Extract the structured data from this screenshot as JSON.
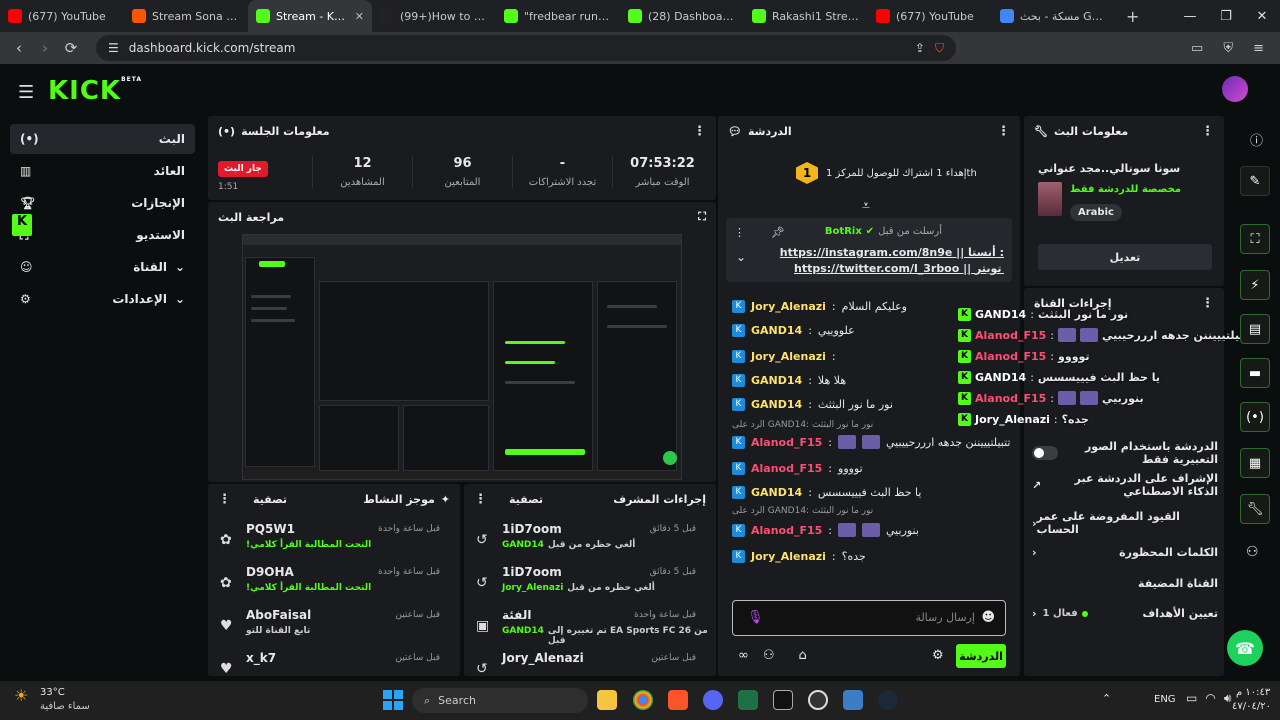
{
  "browser": {
    "tabs": [
      {
        "label": "(677) YouTube",
        "color": "#ff0000"
      },
      {
        "label": "Stream Sona | Listen",
        "color": "#ff5500"
      },
      {
        "label": "Stream - Kick",
        "color": "#53fc18",
        "active": true
      },
      {
        "label": "(99+)How to Down",
        "color": "#222222"
      },
      {
        "label": "\"fredbear running\"",
        "color": "#53fc18"
      },
      {
        "label": "(28) Dashboard / St",
        "color": "#53fc18"
      },
      {
        "label": "Rakashi1 Stream - V",
        "color": "#53fc18"
      },
      {
        "label": "(677) YouTube",
        "color": "#ff0000"
      },
      {
        "label": "مسكة - بحث Google",
        "color": "#4285f4"
      }
    ],
    "url": "dashboard.kick.com/stream"
  },
  "logo": {
    "text": "KICK",
    "beta": "BETA"
  },
  "sidebar": {
    "items": [
      {
        "label": "البث",
        "icon": "broadcast-icon"
      },
      {
        "label": "العائد",
        "icon": "chart-icon"
      },
      {
        "label": "الإنجازات",
        "icon": "trophy-icon"
      },
      {
        "label": "الاستديو",
        "icon": "studio-icon"
      },
      {
        "label": "القناة",
        "icon": "user-icon"
      },
      {
        "label": "الإعدادات",
        "icon": "gear-icon"
      }
    ]
  },
  "session": {
    "title": "معلومات الجلسة",
    "live_badge": "جار البث",
    "live_sub": "1:51",
    "stats": [
      {
        "value": "12",
        "label": "المشاهدين"
      },
      {
        "value": "96",
        "label": "المتابعين"
      },
      {
        "value": "-",
        "label": "تجدد الاشتراكات"
      },
      {
        "value": "07:53:22",
        "label": "الوقت مباشر"
      }
    ]
  },
  "preview": {
    "title": "مراجعة البث"
  },
  "activity": {
    "title": "موجز النشاط",
    "filter": "تصفية",
    "items": [
      {
        "name": "PQ5W1",
        "sub": "!التحت المطالبة القرأ كلامي",
        "time": "قبل ساعة واحدة",
        "icon": "gift-icon"
      },
      {
        "name": "D9OHA",
        "sub": "!التحت المطالبة القرأ كلامي",
        "time": "قبل ساعة واحدة",
        "icon": "gift-icon"
      },
      {
        "name": "AboFaisal",
        "sub": "تابع القناة للتو",
        "time": "قبل ساعتين",
        "icon": "heart-icon"
      },
      {
        "name": "x_k7",
        "sub": "",
        "time": "قبل ساعتين",
        "icon": "heart-icon"
      }
    ]
  },
  "modactions": {
    "title": "إجراءات المشرف",
    "filter": "تصفية",
    "items": [
      {
        "name": "1iD7oom",
        "sub": "ألغي حظره من قبل",
        "by": "GAND14",
        "time": "قبل 5 دقائق"
      },
      {
        "name": "1iD7oom",
        "sub": "ألغي حظره من قبل",
        "by": "Jory_Alenazi",
        "time": "قبل 5 دقائق"
      },
      {
        "name": "الفئة",
        "sub": "تم تغييره إلى EA Sports FC 26 من قبل",
        "by": "GAND14",
        "time": "قبل ساعة واحدة"
      },
      {
        "name": "Jory_Alenazi",
        "sub": "",
        "by": "",
        "time": "قبل ساعتين"
      }
    ]
  },
  "chat": {
    "title": "الدردشة",
    "goal": "إهداء 1 اشتراك للوصول للمركز 1th",
    "goal_rank": "1",
    "pinned_user": "BotRix",
    "pinned_label": "أرسلت من قبل",
    "pinned_line1": "https://instagram.com/8n9e || أنستا :",
    "pinned_line2": "https://twitter.com/l_3rboo || تويتر :",
    "messages": [
      {
        "user": "Jory_Alenazi",
        "text": "وعليكم السلام",
        "color": "y"
      },
      {
        "user": "GAND14",
        "text": "علووييي",
        "color": "y"
      },
      {
        "user": "Jory_Alenazi",
        "text": "",
        "color": "y"
      },
      {
        "user": "GAND14",
        "text": "هلا هلا",
        "color": "y"
      },
      {
        "user": "GAND14",
        "text": "نور ما نور البثثث",
        "color": "y"
      },
      {
        "user": "Alanod_F15",
        "text": "تتبيلتيييننن جدهه ارررحييبيي",
        "color": "p"
      },
      {
        "user": "Alanod_F15",
        "text": "توووو",
        "color": "p"
      },
      {
        "user": "GAND14",
        "text": "يا حظ البث فيييسسس",
        "color": "y"
      },
      {
        "user": "Alanod_F15",
        "text": "بنوربيي",
        "color": "p"
      },
      {
        "user": "Jory_Alenazi",
        "text": "جده؟",
        "color": "y"
      }
    ],
    "reply1": "الرد على GAND14: نور ما نور البثثث",
    "reply2": "الرد على GAND14: نور ما نور البثثث",
    "input_placeholder": "إرسال رسالة",
    "send_label": "الدردشة"
  },
  "streaminfo": {
    "title": "معلومات البث",
    "stream_title": "سونا سونالي..مجد عنواني",
    "category": "مخصصة للدردشة فقط",
    "lang": "Arabic",
    "edit": "تعديل"
  },
  "channel_actions": {
    "title": "إجراءات القناة",
    "rows": [
      {
        "label": "الدردشة باستخدام الصور التعبيرية فقط",
        "kind": "toggle"
      },
      {
        "label": "الإشراف على الدردشة عبر الذكاء الاصطناعي",
        "kind": "link"
      },
      {
        "label": "القيود المفروضة على عمر الحساب",
        "kind": "chevron"
      },
      {
        "label": "الكلمات المحظورة",
        "kind": "chevron"
      },
      {
        "label": "القناة المضيفة",
        "kind": "none"
      },
      {
        "label": "تعيين الأهداف",
        "kind": "goal",
        "extra": "فعال 1"
      }
    ]
  },
  "overlay_chat": [
    {
      "user": "GAND14",
      "text": "نور ما نور البثثث",
      "color": "w"
    },
    {
      "user": "Alanod_F15",
      "text": "تتبيلتيييننن جدهه ارررحيبيي",
      "color": "p"
    },
    {
      "user": "Alanod_F15",
      "text": "توووو",
      "color": "p"
    },
    {
      "user": "GAND14",
      "text": "يا حظ البث فيييسسس",
      "color": "w"
    },
    {
      "user": "Alanod_F15",
      "text": "بنوربيي",
      "color": "p"
    },
    {
      "user": "Jory_Alenazi",
      "text": "جده؟",
      "color": "w"
    }
  ],
  "taskbar": {
    "weather_temp": "33°C",
    "weather_desc": "سماء صافية",
    "search": "Search",
    "lang": "ENG",
    "time": "١٠:٤٣ م",
    "date": "٤٧/٠٤/٢٠"
  },
  "colors": {
    "accent": "#53fc18",
    "live": "#e5192c",
    "username_pink": "#ff4d73",
    "username_yellow": "#ffe26b"
  }
}
